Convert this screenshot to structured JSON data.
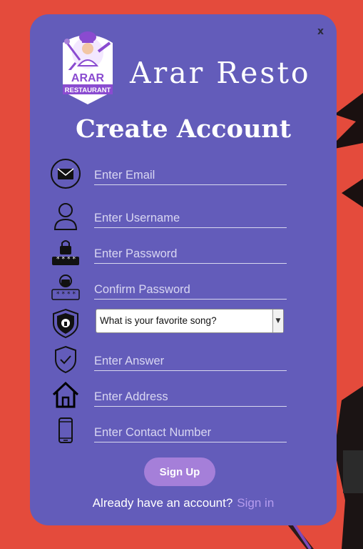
{
  "window": {
    "close_label": "x"
  },
  "logo": {
    "line1": "ARAR",
    "line2": "RESTAURANT"
  },
  "brand": {
    "name": "Arar Resto"
  },
  "form": {
    "title": "Create Account",
    "fields": {
      "email": {
        "placeholder": "Enter Email",
        "icon": "envelope-icon"
      },
      "username": {
        "placeholder": "Enter Username",
        "icon": "user-icon"
      },
      "password": {
        "placeholder": "Enter Password",
        "icon": "lock-icon",
        "mask": "****"
      },
      "confirm_password": {
        "placeholder": "Confirm Password",
        "icon": "lock-icon",
        "mask": "****"
      },
      "security_question": {
        "selected": "What is your favorite song?",
        "icon": "shield-icon"
      },
      "answer": {
        "placeholder": "Enter Answer",
        "icon": "check-shield-icon"
      },
      "address": {
        "placeholder": "Enter Address",
        "icon": "house-icon"
      },
      "contact": {
        "placeholder": "Enter Contact Number",
        "icon": "phone-icon"
      }
    },
    "signup_label": "Sign Up",
    "footer_text": "Already have an account?",
    "signin_label": "Sign in"
  },
  "colors": {
    "background": "#e44b3c",
    "card": "#635cba",
    "button": "#a57fd9",
    "link": "#b59cee"
  }
}
